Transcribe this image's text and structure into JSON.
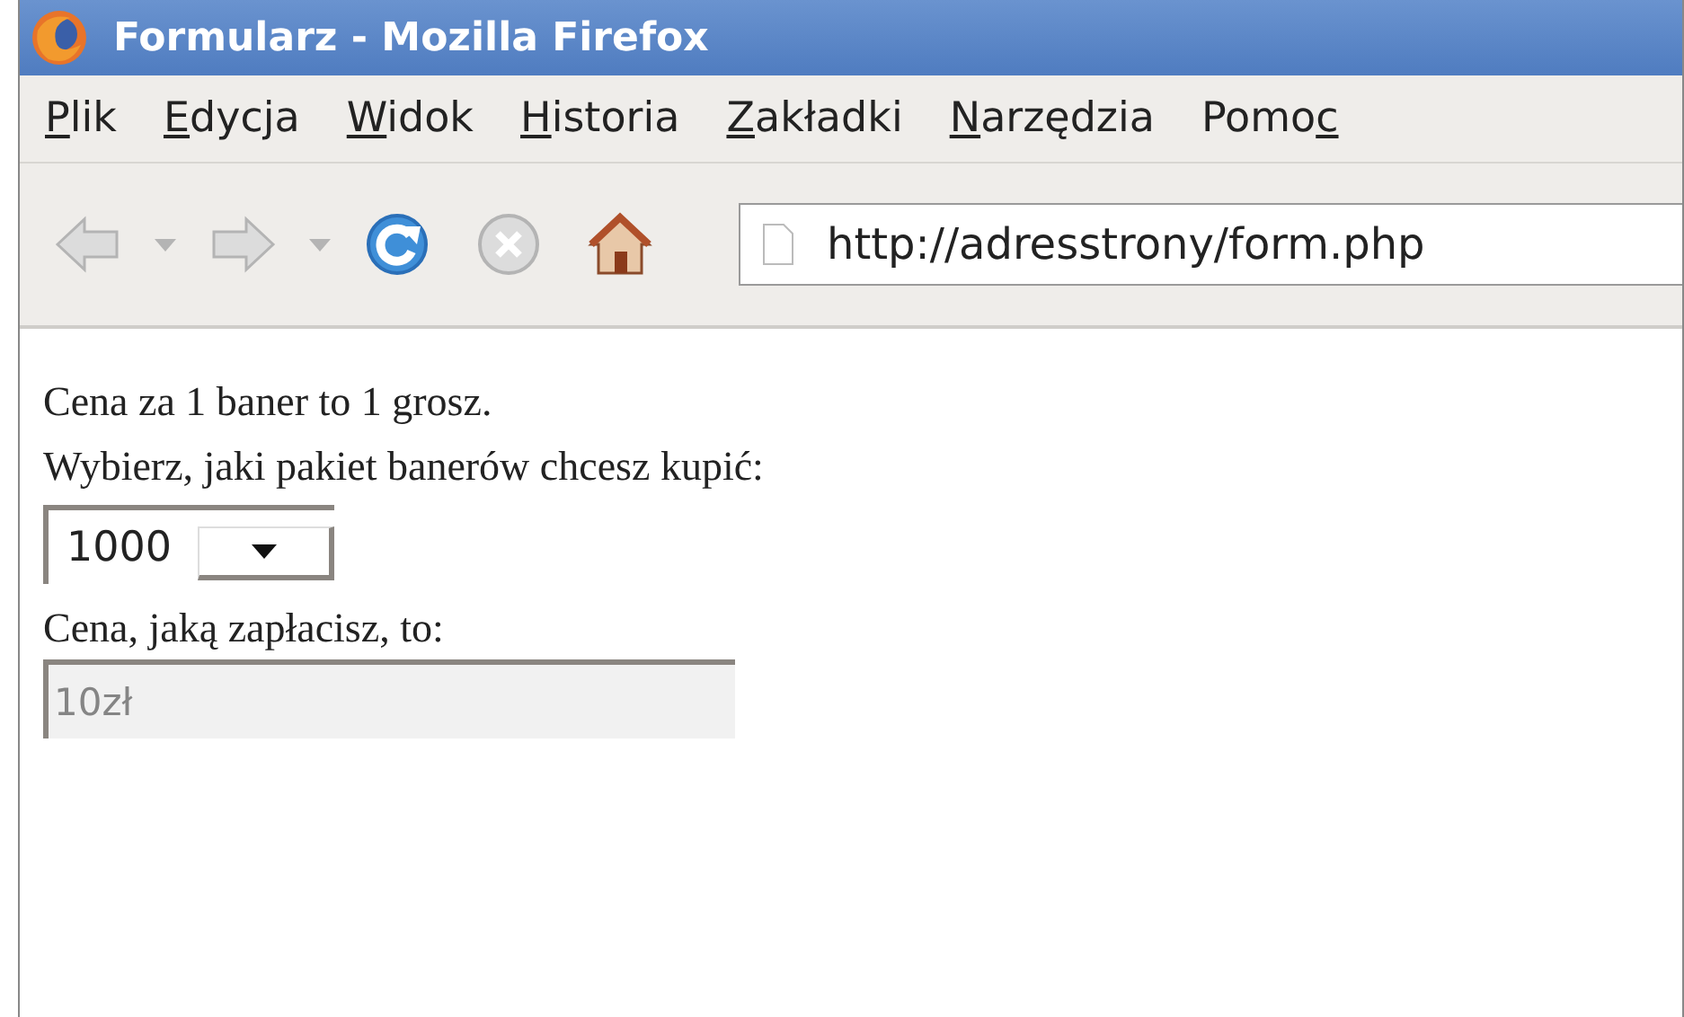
{
  "window": {
    "title": "Formularz - Mozilla Firefox"
  },
  "menu": [
    {
      "key": "P",
      "after": "lik"
    },
    {
      "key": "E",
      "after": "dycja"
    },
    {
      "key": "W",
      "after": "idok"
    },
    {
      "key": "H",
      "after": "istoria"
    },
    {
      "key": "Z",
      "after": "akładki"
    },
    {
      "key": "N",
      "after": "arzędzia"
    },
    {
      "before": "Pomo",
      "key": "c"
    }
  ],
  "toolbar": [
    {
      "kind": "back",
      "disabled": true
    },
    {
      "kind": "history",
      "disabled": true
    },
    {
      "kind": "forward",
      "disabled": true
    },
    {
      "kind": "history",
      "disabled": true
    },
    {
      "kind": "reload",
      "disabled": false
    },
    {
      "kind": "stop",
      "disabled": true
    },
    {
      "kind": "home",
      "disabled": false
    }
  ],
  "address": {
    "value": "http://adresstrony/form.php"
  },
  "page": {
    "price_note": "Cena za 1 baner to 1 grosz.",
    "choose_label": "Wybierz, jaki pakiet banerów chcesz kupić:",
    "package_select": {
      "value": "1000"
    },
    "total_label": "Cena, jaką zapłacisz, to:",
    "total_field": {
      "value": "10zł",
      "disabled": true
    }
  }
}
